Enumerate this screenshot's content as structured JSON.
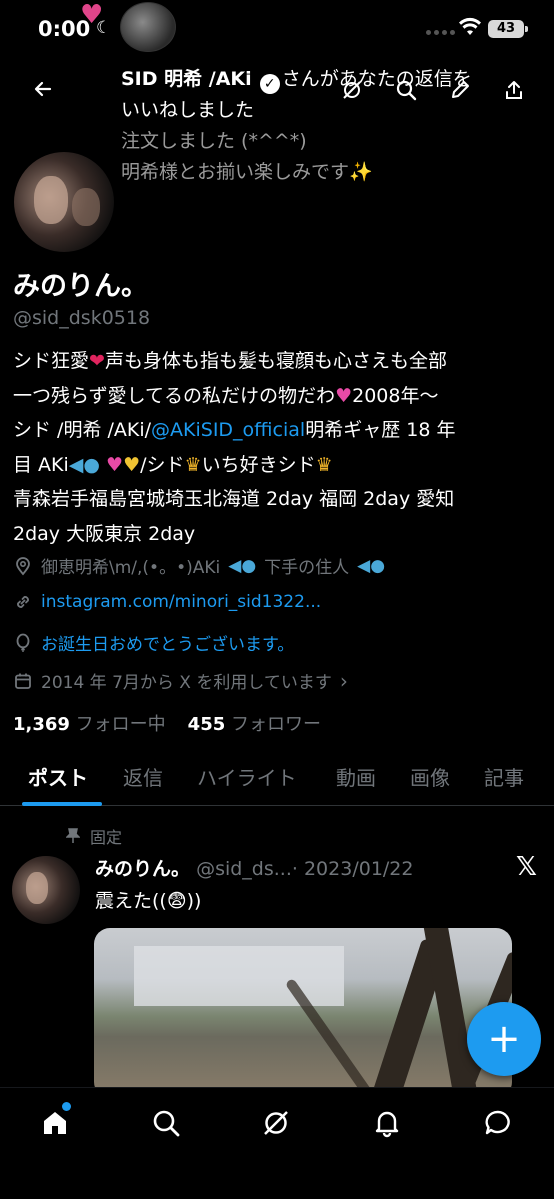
{
  "status_bar": {
    "time": "0:00",
    "battery": "43"
  },
  "notification": {
    "sender": "SID 明希 /AKi",
    "text_line1_rest": "さんがあなたの返信を",
    "text_line2": "いいねしました",
    "quote_line1": "注文しました (*^^*)",
    "quote_line2": "明希様とお揃い楽しみです✨"
  },
  "profile": {
    "display_name": "みのりん。",
    "handle": "@sid_dsk0518",
    "bio": {
      "l1a": "シド狂愛",
      "l1b": "声も身体も指も髪も寝顔も心さえも全部",
      "l2a": "一つ残らず愛してるの私だけの物だわ",
      "l2b": "2008年〜",
      "l3a": "シド /明希 /AKi/",
      "l3link": "@AKiSID_official",
      "l3b": "明希ギャ歴 18 年",
      "l4a": "目 AKi",
      "l4b": "/シド",
      "l4c": "いち好きシド",
      "l5": "青森岩手福島宮城埼玉北海道 2day 福岡 2day 愛知",
      "l6": "2day 大阪東京 2day"
    },
    "location": "御恵明希\\m/,(•。•)AKi",
    "location_tail": "下手の住人",
    "website": "instagram.com/minori_sid1322...",
    "birthday": "お誕生日おめでとうございます。",
    "joined": "2014 年 7月から X を利用しています",
    "following_count": "1,369",
    "following_label": "フォロー中",
    "followers_count": "455",
    "followers_label": "フォロワー"
  },
  "tabs": [
    "ポスト",
    "返信",
    "ハイライト",
    "動画",
    "画像",
    "記事"
  ],
  "post": {
    "pinned_label": "固定",
    "author_name": "みのりん。",
    "author_handle": "@sid_ds...",
    "date": "· 2023/01/22",
    "text": "震えた((😨))"
  },
  "fab_label": "+",
  "colors": {
    "accent": "#1d9bf0",
    "background": "#000000",
    "muted": "#71767b"
  }
}
